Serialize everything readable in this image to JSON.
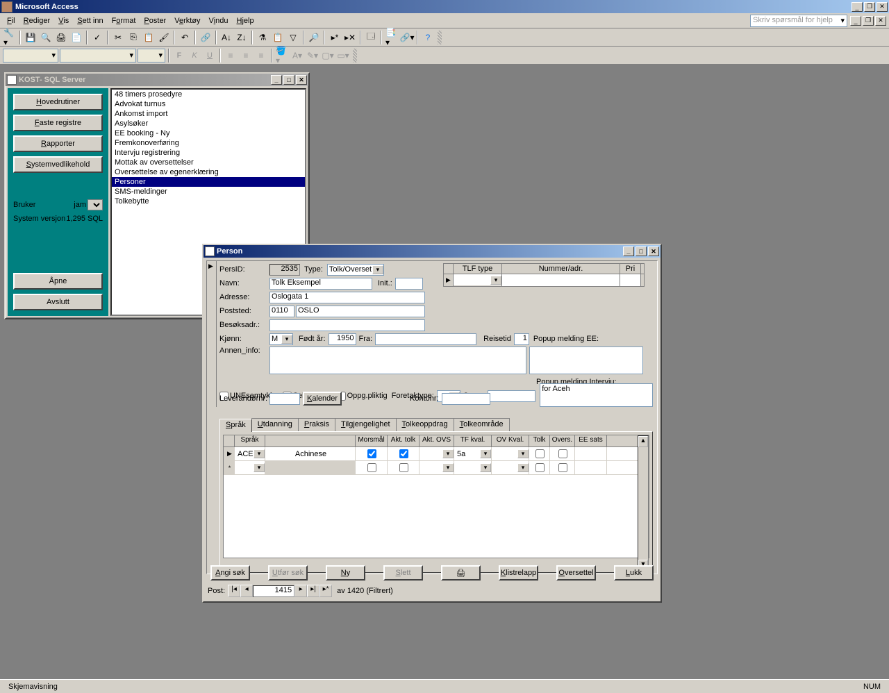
{
  "app": {
    "title": "Microsoft Access"
  },
  "menu": {
    "items": [
      "Fil",
      "Rediger",
      "Vis",
      "Sett inn",
      "Format",
      "Poster",
      "Verktøy",
      "Vindu",
      "Hjelp"
    ],
    "helpPlaceholder": "Skriv spørsmål for hjelp"
  },
  "kostWindow": {
    "title": "KOST- SQL Server",
    "buttons": {
      "hovedrutiner": "Hovedrutiner",
      "faste": "Faste registre",
      "rapporter": "Rapporter",
      "systemvedlikehold": "Systemvedlikehold",
      "apne": "Åpne",
      "avslutt": "Avslutt"
    },
    "brukerLabel": "Bruker",
    "brukerValue": "jam",
    "versjonLabel": "System versjon",
    "versjonValue": "1,295 SQL",
    "listItems": [
      "48 timers prosedyre",
      "Advokat turnus",
      "Ankomst import",
      "Asylsøker",
      "EE booking - Ny",
      "Fremkonoverføring",
      "Intervju registrering",
      "Mottak av oversettelser",
      "Oversettelse av egenerklæring",
      "Personer",
      "SMS-meldinger",
      "Tolkebytte"
    ],
    "selectedIndex": 9
  },
  "personWindow": {
    "title": "Person",
    "labels": {
      "persId": "PersID:",
      "type": "Type:",
      "navn": "Navn:",
      "init": "Init.:",
      "adresse": "Adresse:",
      "poststed": "Poststed:",
      "besoksadr": "Besøksadr.:",
      "kjonn": "Kjønn:",
      "fodtAr": "Født år:",
      "fra": "Fra:",
      "reisetid": "Reisetid",
      "popupEE": "Popup melding EE:",
      "annenInfo": "Annen_info:",
      "popupIntervju": "Popup melding Intervju:",
      "uneSamtykke": "UNEsamtykke",
      "selvstendig": "Selvstendig",
      "oppgPliktig": "Oppg.pliktig",
      "foretaktype": "Foretaktype:",
      "orgnr": "Orgnr:",
      "leverandornr": "Leverandørnr:",
      "kalender": "Kalender",
      "kontonr": "Kontonr:",
      "tlfType": "TLF type",
      "nummerAdr": "Nummer/adr.",
      "pri": "Pri"
    },
    "values": {
      "persId": "2535",
      "type": "Tolk/Overset",
      "navn": "Tolk Eksempel",
      "init": "",
      "adresse": "Oslogata 1",
      "postnr": "0110",
      "poststed": "OSLO",
      "besoksadr": "",
      "kjonn": "M",
      "fodtAr": "1950",
      "fra": "",
      "reisetid": "1",
      "annenInfo": "",
      "popupEE": "",
      "popupIntervju": "for Aceh",
      "foretaktype": "",
      "orgnr": "",
      "leverandornr": "",
      "kontonr": ""
    },
    "tabs": [
      "Språk",
      "Utdanning",
      "Praksis",
      "Tilgjengelighet",
      "Tolkeoppdrag",
      "Tolkeområde"
    ],
    "activeTab": 0,
    "sprakGrid": {
      "headers": [
        "Språk",
        "",
        "Morsmål",
        "Akt. tolk",
        "Akt. OVS",
        "TF kval.",
        "OV Kval.",
        "Tolk",
        "Overs.",
        "EE sats"
      ],
      "rows": [
        {
          "marker": "▶",
          "code": "ACE",
          "name": "Achinese",
          "morsmal": true,
          "aktTolk": true,
          "aktOvs": "",
          "tfKval": "5a",
          "ovKval": "",
          "tolk": false,
          "overs": false,
          "eeSats": ""
        },
        {
          "marker": "*",
          "code": "",
          "name": "",
          "morsmal": false,
          "aktTolk": false,
          "aktOvs": "",
          "tfKval": "",
          "ovKval": "",
          "tolk": false,
          "overs": false,
          "eeSats": ""
        }
      ]
    },
    "bottomButtons": {
      "angiSok": "Angi søk",
      "utforSok": "Utfør søk",
      "ny": "Ny",
      "slett": "Slett",
      "klistrelapp": "Klistrelapp",
      "oversettel": "Oversettel",
      "lukk": "Lukk"
    },
    "recNav": {
      "label": "Post:",
      "current": "1415",
      "total": "1420",
      "suffix": "(Filtrert)"
    }
  },
  "statusbar": {
    "view": "Skjemavisning",
    "num": "NUM"
  }
}
